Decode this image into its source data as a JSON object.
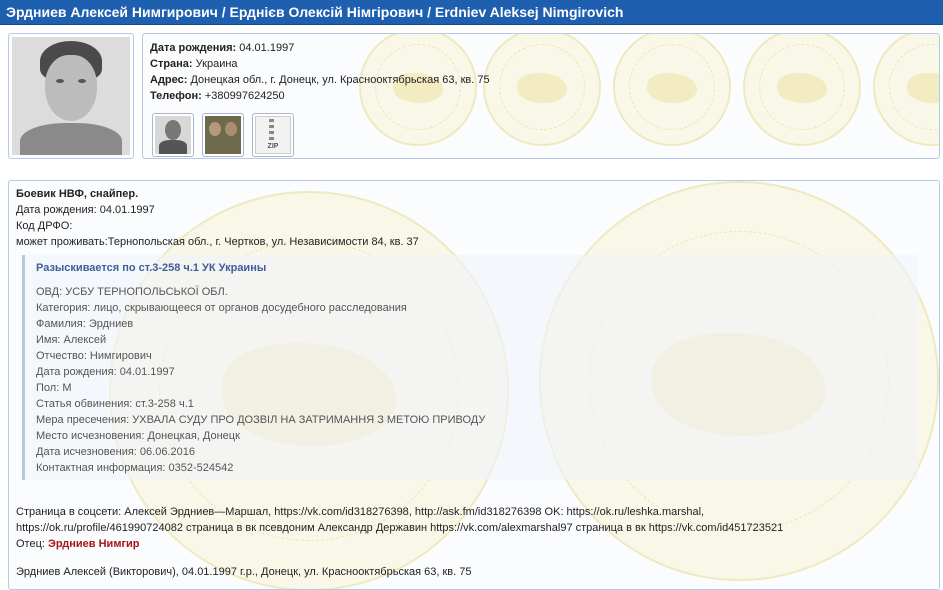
{
  "title": "Эрдниев Алексей Нимгирович / Ерднієв Олексій Німгірович / Erdniev Aleksej Nimgirovich",
  "info": {
    "birth_label": "Дата рождения:",
    "birth_value": "04.01.1997",
    "country_label": "Страна:",
    "country_value": "Украина",
    "address_label": "Адрес:",
    "address_value": "Донецкая обл., г. Донецк, ул. Краснооктябрьская 63, кв. 75",
    "phone_label": "Телефон:",
    "phone_value": "+380997624250",
    "zip_label": "ZIP"
  },
  "body": {
    "heading": "Боевик НВФ, снайпер.",
    "birth_line": "Дата рождения: 04.01.1997",
    "drfo_line": "Код ДРФО:",
    "residence_line": "может проживать:Тернопольская обл., г. Чертков, ул. Независимости 84, кв. 37",
    "wanted": {
      "title": "Разыскивается по ст.3-258 ч.1 УК Украины",
      "rows": [
        "ОВД: УСБУ ТЕРНОПОЛЬСЬКОЇ ОБЛ.",
        "Категория: лицо, скрывающееся от органов досудебного расследования",
        "Фамилия: Эрдниев",
        "Имя: Алексей",
        "Отчество: Нимгирович",
        "Дата рождения: 04.01.1997",
        "Пол: М",
        "Статья обвинения: ст.3-258 ч.1",
        "Мера пресечения: УХВАЛА СУДУ ПРО ДОЗВІЛ НА ЗАТРИМАННЯ З МЕТОЮ ПРИВОДУ",
        "Место исчезновения: Донецкая, Донецк",
        "Дата исчезновения: 06.06.2016",
        "Контактная информация: 0352-524542"
      ]
    },
    "social_line1": "Страница в соцсети: Алексей Эрдниев—Маршал, https://vk.com/id318276398, http://ask.fm/id318276398 OK: https://ok.ru/leshka.marshal,",
    "social_line2": "https://ok.ru/profile/461990724082 страница в вк псевдоним Александр Державин  https://vk.com/alexmarshal97  страница в вк https://vk.com/id451723521",
    "father_label": "Отец:",
    "father_name": "Эрдниев Нимгир",
    "last_line": "Эрдниев Алексей (Викторович), 04.01.1997 г.р., Донецк, ул. Краснооктябрьская 63, кв. 75"
  }
}
